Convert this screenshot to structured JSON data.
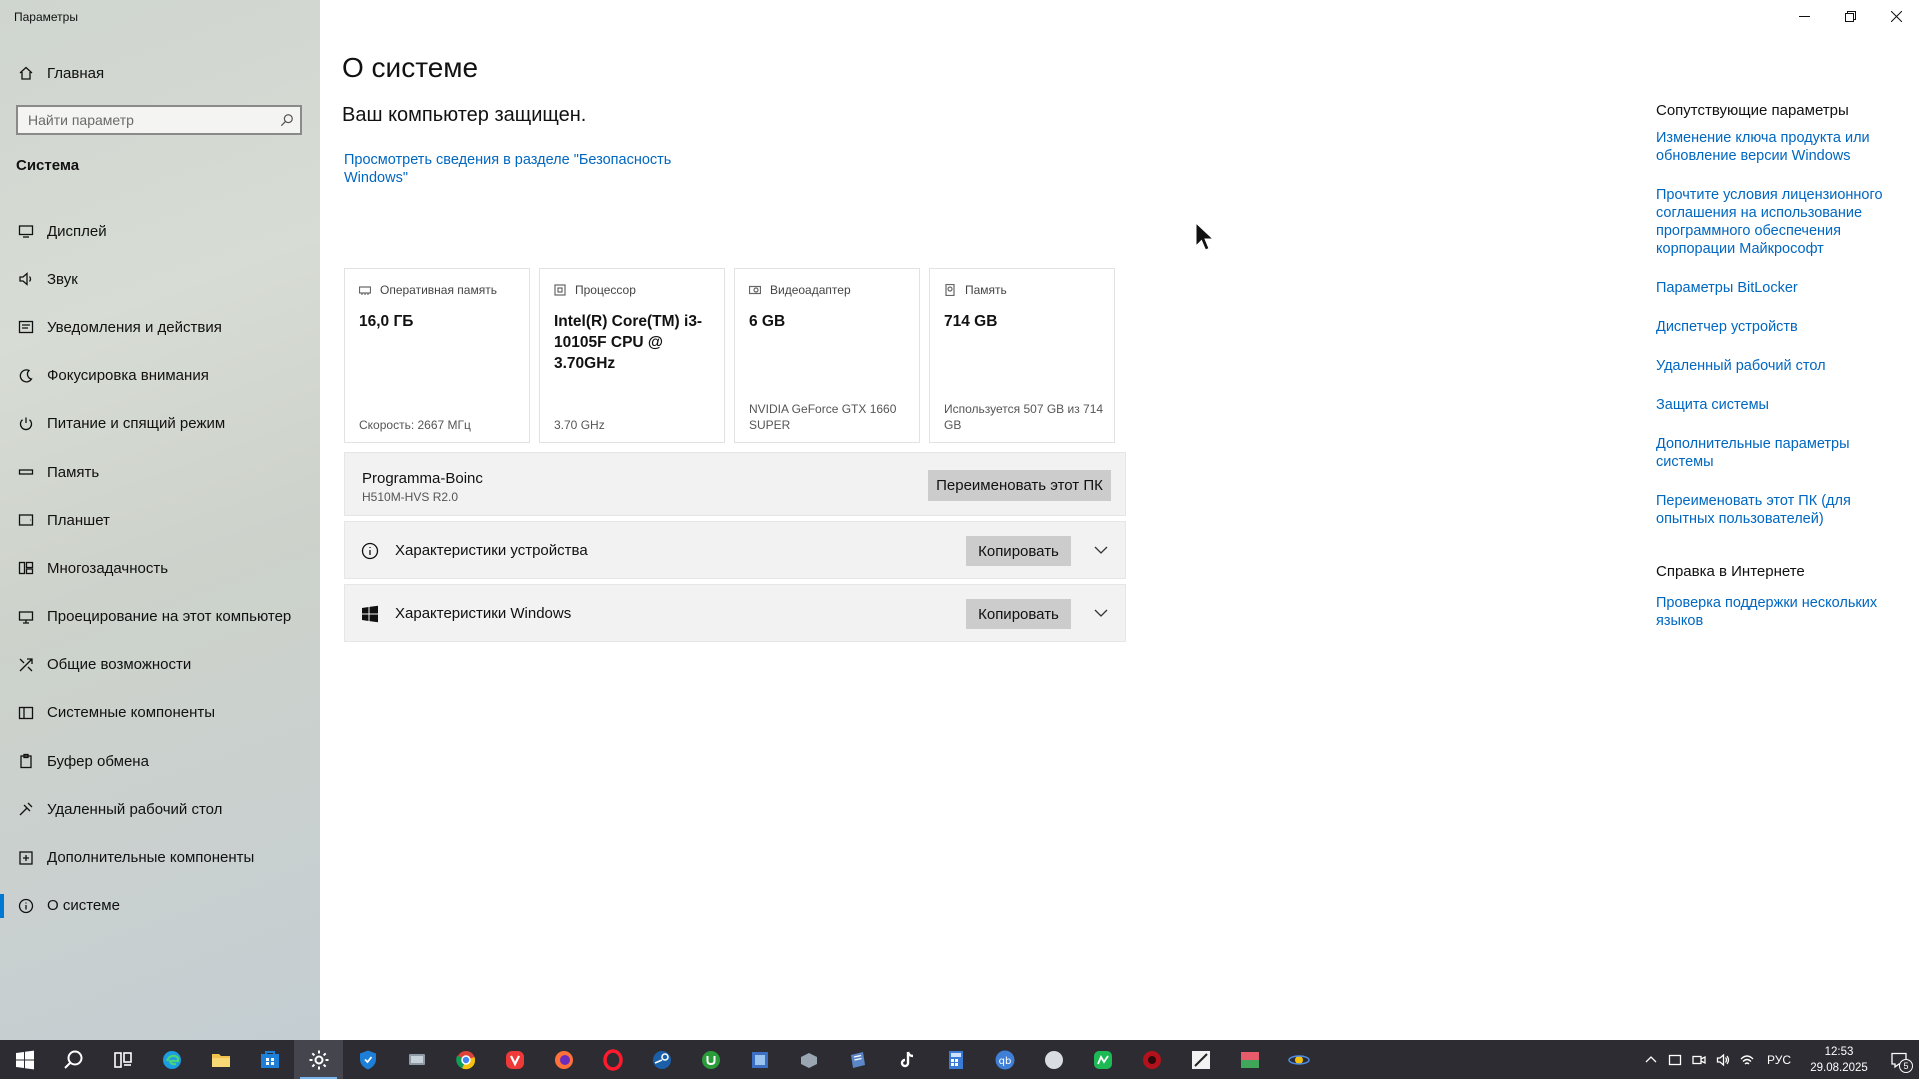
{
  "window": {
    "title": "Параметры"
  },
  "sidebar": {
    "home_label": "Главная",
    "search_placeholder": "Найти параметр",
    "section_title": "Система",
    "items": [
      {
        "label": "Дисплей",
        "icon": "display-icon"
      },
      {
        "label": "Звук",
        "icon": "sound-icon"
      },
      {
        "label": "Уведомления и действия",
        "icon": "notifications-icon"
      },
      {
        "label": "Фокусировка внимания",
        "icon": "focus-assist-icon"
      },
      {
        "label": "Питание и спящий режим",
        "icon": "power-icon"
      },
      {
        "label": "Память",
        "icon": "storage-icon"
      },
      {
        "label": "Планшет",
        "icon": "tablet-icon"
      },
      {
        "label": "Многозадачность",
        "icon": "multitasking-icon"
      },
      {
        "label": "Проецирование на этот компьютер",
        "icon": "projecting-icon"
      },
      {
        "label": "Общие возможности",
        "icon": "shared-experiences-icon"
      },
      {
        "label": "Системные компоненты",
        "icon": "system-components-icon"
      },
      {
        "label": "Буфер обмена",
        "icon": "clipboard-icon"
      },
      {
        "label": "Удаленный рабочий стол",
        "icon": "remote-desktop-icon"
      },
      {
        "label": "Дополнительные компоненты",
        "icon": "optional-features-icon"
      },
      {
        "label": "О системе",
        "icon": "info-icon",
        "active": true
      }
    ]
  },
  "main": {
    "title": "О системе",
    "protection_status": "Ваш компьютер защищен.",
    "security_link": "Просмотреть сведения в разделе \"Безопасность Windows\"",
    "cards": [
      {
        "label": "Оперативная память",
        "value": "16,0 ГБ",
        "sub": "Скорость: 2667 МГц",
        "icon": "ram-icon"
      },
      {
        "label": "Процессор",
        "value": "Intel(R) Core(TM) i3-10105F CPU @ 3.70GHz",
        "sub": "3.70 GHz",
        "icon": "cpu-icon"
      },
      {
        "label": "Видеоадаптер",
        "value": "6 GB",
        "sub": "NVIDIA GeForce GTX 1660 SUPER",
        "icon": "gpu-icon"
      },
      {
        "label": "Память",
        "value": "714 GB",
        "sub": "Используется 507 GB из 714 GB",
        "icon": "disk-icon"
      }
    ],
    "pc": {
      "name": "Programma-Boinc",
      "model": "H510M-HVS R2.0",
      "rename_label": "Переименовать этот ПК"
    },
    "device_specs": {
      "label": "Характеристики устройства",
      "copy_label": "Копировать"
    },
    "windows_specs": {
      "label": "Характеристики Windows",
      "copy_label": "Копировать"
    }
  },
  "related": {
    "title": "Сопутствующие параметры",
    "links": [
      "Изменение ключа продукта или обновление версии Windows",
      "Прочтите условия лицензионного соглашения на использование программного обеспечения корпорации Майкрософт",
      "Параметры BitLocker",
      "Диспетчер устройств",
      "Удаленный рабочий стол",
      "Защита системы",
      "Дополнительные параметры системы",
      "Переименовать этот ПК (для опытных пользователей)"
    ],
    "help_title": "Справка в Интернете",
    "help_links": [
      "Проверка поддержки нескольких языков"
    ]
  },
  "taskbar": {
    "apps": [
      "start-icon",
      "search-icon",
      "task-view-icon",
      "edge-icon",
      "file-explorer-icon",
      "store-icon",
      "settings-icon",
      "defender-icon",
      "app-icon",
      "chrome-icon",
      "vivaldi-icon",
      "firefox-icon",
      "opera-icon",
      "steam-icon",
      "utorrent-icon",
      "app2-icon",
      "app3-icon",
      "app4-icon",
      "tiktok-icon",
      "calculator-icon",
      "qbittorrent-icon",
      "app5-icon",
      "app6-icon",
      "app7-icon",
      "app8-icon",
      "app9-icon",
      "boinc-icon"
    ],
    "active_app": "settings-icon",
    "language": "РУС",
    "time": "12:53",
    "date": "29.08.2025",
    "notification_count": "5"
  },
  "colors": {
    "accent": "#0078d4",
    "link": "#0067c0",
    "taskbar": "#2c2c32"
  }
}
